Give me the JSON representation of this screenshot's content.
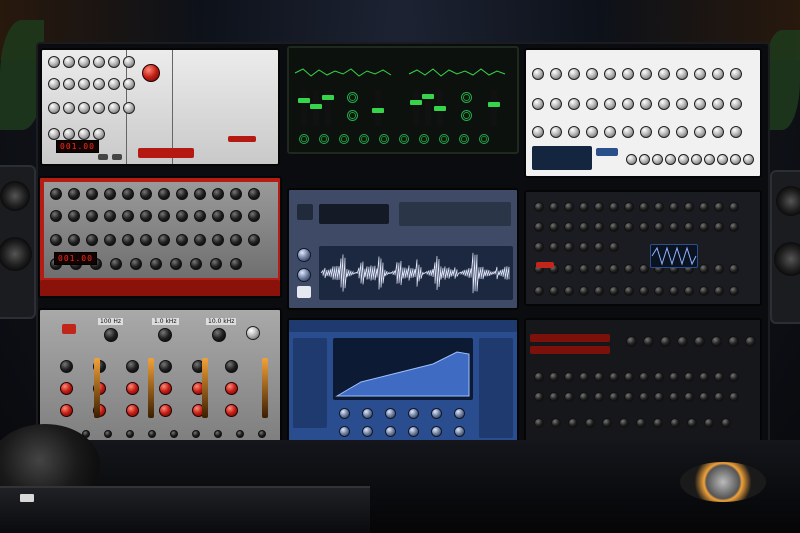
{
  "scene": {
    "accent_colors": {
      "analog_red": "#c2261a",
      "green_lcd": "#36d44a",
      "blue_ui": "#2a4d8f",
      "amber": "#f2a23a",
      "silver": "#d8d8d8"
    }
  },
  "plugins": [
    {
      "id": "silver-analog-synth",
      "lcd": "001.00",
      "theme": "silver"
    },
    {
      "id": "green-lcd-synth",
      "theme": "black-green"
    },
    {
      "id": "white-modular-synth",
      "theme": "white"
    },
    {
      "id": "red-analog-synth",
      "lcd": "001.00",
      "theme": "red"
    },
    {
      "id": "sampler-waveform",
      "theme": "slate"
    },
    {
      "id": "dark-synth",
      "theme": "black"
    },
    {
      "id": "channel-strip-eq",
      "freqs": [
        "100 Hz",
        "1.0 kHz",
        "10.0 kHz"
      ],
      "theme": "gray"
    },
    {
      "id": "blue-wavetable-synth",
      "theme": "blue"
    },
    {
      "id": "black-red-synth",
      "theme": "black-red"
    }
  ]
}
